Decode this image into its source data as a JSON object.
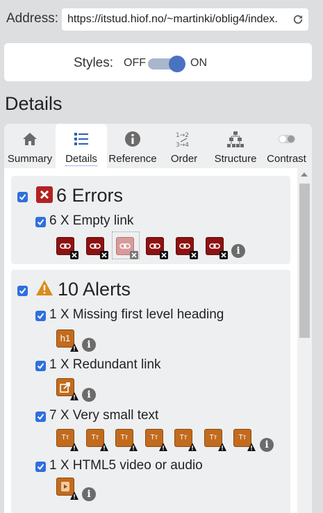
{
  "address": {
    "label": "Address:",
    "url": "https://itstud.hiof.no/~martinki/oblig4/index."
  },
  "styles": {
    "label": "Styles:",
    "off": "OFF",
    "on": "ON",
    "state": "on"
  },
  "section_heading": "Details",
  "tabs": [
    {
      "label": "Summary",
      "icon": "home-icon"
    },
    {
      "label": "Details",
      "icon": "list-icon",
      "active": true
    },
    {
      "label": "Reference",
      "icon": "info-icon"
    },
    {
      "label": "Order",
      "icon": "order-icon"
    },
    {
      "label": "Structure",
      "icon": "structure-icon"
    },
    {
      "label": "Contrast",
      "icon": "contrast-icon"
    }
  ],
  "errors": {
    "title": "6 Errors",
    "items": [
      {
        "label": "6 X Empty link",
        "count": 6
      }
    ]
  },
  "alerts": {
    "title": "10 Alerts",
    "items": [
      {
        "label": "1 X Missing first level heading",
        "count": 1,
        "badge_text": "h1"
      },
      {
        "label": "1 X Redundant link",
        "count": 1
      },
      {
        "label": "7 X Very small text",
        "count": 7,
        "badge_text": "Tт"
      },
      {
        "label": "1 X HTML5 video or audio",
        "count": 1
      }
    ]
  },
  "colors": {
    "accent": "#2f6fde",
    "error": "#8e1212",
    "alert": "#c26b1d",
    "toggle_knob": "#4a72c2"
  }
}
